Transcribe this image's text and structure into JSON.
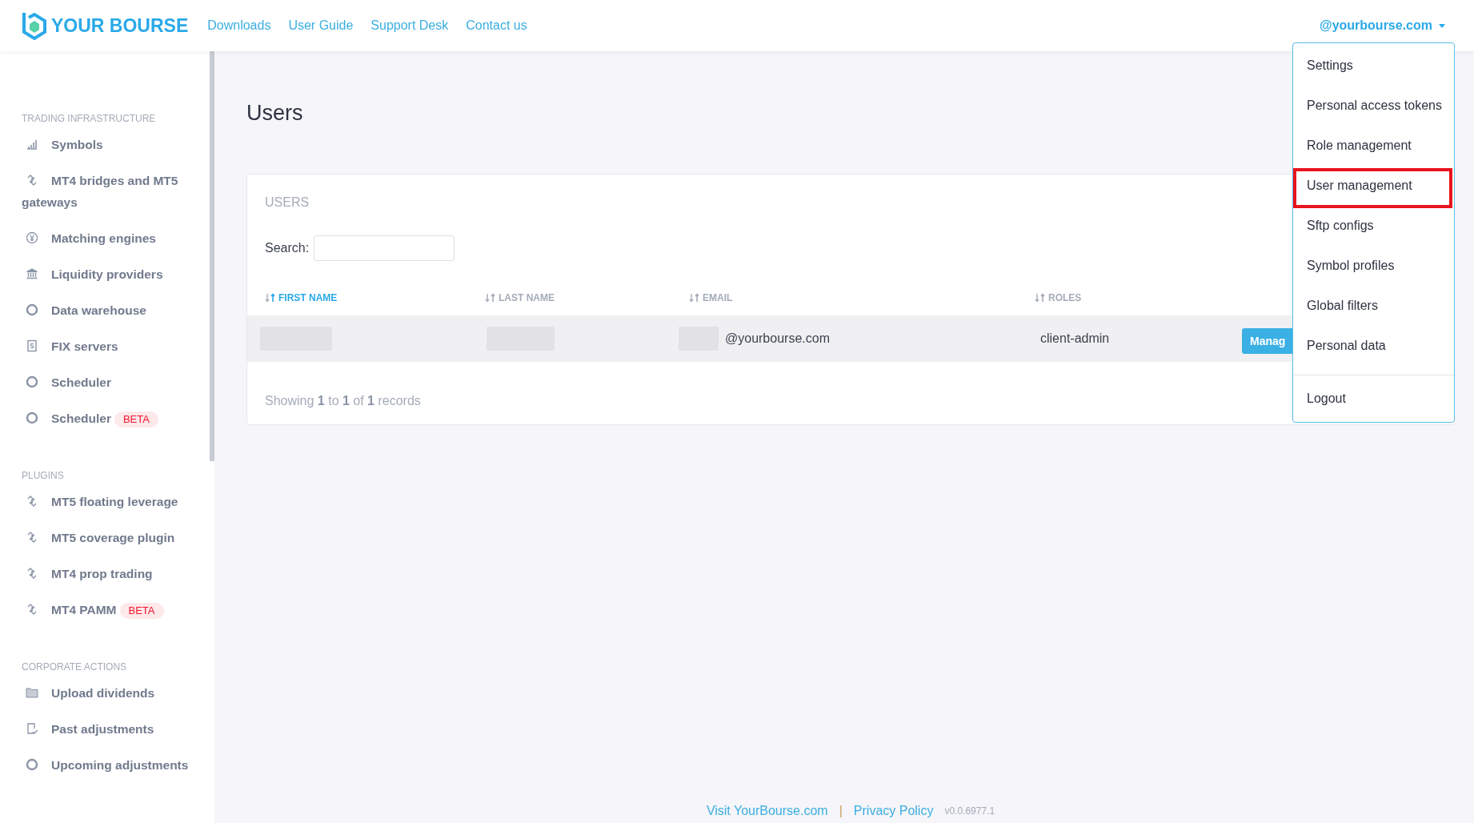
{
  "header": {
    "logo": "YOUR BOURSE",
    "nav": [
      "Downloads",
      "User Guide",
      "Support Desk",
      "Contact us"
    ],
    "account": "@yourbourse.com"
  },
  "sidebar": {
    "sections": [
      {
        "title": "TRADING INFRASTRUCTURE",
        "items": [
          {
            "label": "Symbols"
          },
          {
            "label": "MT4 bridges and MT5 gateways"
          },
          {
            "label": "Matching engines"
          },
          {
            "label": "Liquidity providers"
          },
          {
            "label": "Data warehouse"
          },
          {
            "label": "FIX servers"
          },
          {
            "label": "Scheduler"
          },
          {
            "label": "Scheduler",
            "badge": "BETA"
          }
        ]
      },
      {
        "title": "PLUGINS",
        "items": [
          {
            "label": "MT5 floating leverage"
          },
          {
            "label": "MT5 coverage plugin"
          },
          {
            "label": "MT4 prop trading"
          },
          {
            "label": "MT4 PAMM",
            "badge": "BETA"
          }
        ]
      },
      {
        "title": "CORPORATE ACTIONS",
        "items": [
          {
            "label": "Upload dividends"
          },
          {
            "label": "Past adjustments"
          },
          {
            "label": "Upcoming adjustments"
          }
        ]
      }
    ]
  },
  "page": {
    "title": "Users",
    "card_title": "USERS",
    "search": {
      "label": "Search:"
    },
    "table": {
      "columns": [
        {
          "label": "FIRST NAME",
          "sorted": true
        },
        {
          "label": "LAST NAME",
          "sorted": false
        },
        {
          "label": "EMAIL",
          "sorted": false
        },
        {
          "label": "ROLES",
          "sorted": false
        }
      ],
      "rows": [
        {
          "email": "@yourbourse.com",
          "roles": "client-admin",
          "action": "Manag"
        }
      ]
    },
    "summary": "Showing **1** to **1** of **1** records"
  },
  "dropdown": {
    "items": [
      {
        "label": "Settings",
        "highlighted": false
      },
      {
        "label": "Personal access tokens",
        "highlighted": false
      },
      {
        "label": "Role management",
        "highlighted": false
      },
      {
        "label": "User management",
        "highlighted": true
      },
      {
        "label": "Sftp configs",
        "highlighted": false
      },
      {
        "label": "Symbol profiles",
        "highlighted": false
      },
      {
        "label": "Global filters",
        "highlighted": false
      },
      {
        "label": "Personal data",
        "highlighted": false
      }
    ],
    "footer_item": "Logout"
  },
  "footer": {
    "links": [
      "Visit YourBourse.com",
      "Privacy Policy"
    ],
    "separator": "|",
    "version": "v0.0.6977.1"
  }
}
